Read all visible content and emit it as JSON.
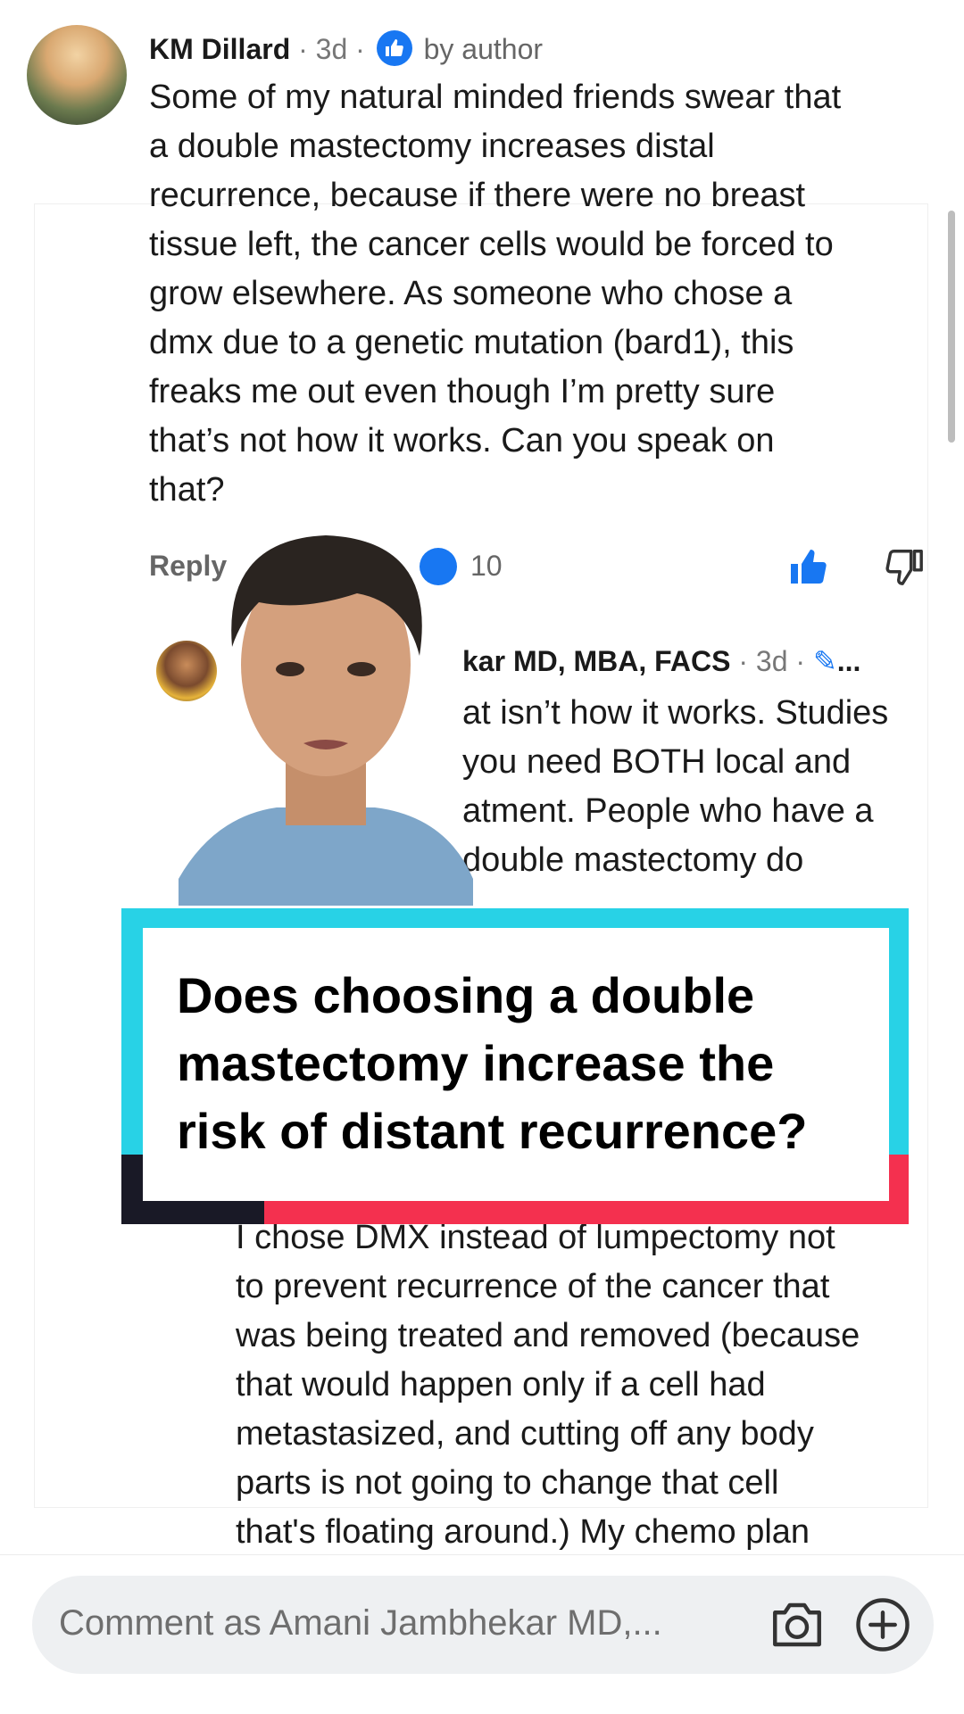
{
  "comment": {
    "author": "KM Dillard",
    "age": "3d",
    "badge_text": "by author",
    "text": "Some of my natural minded friends swear that\na double mastectomy increases distal\nrecurrence, because if there were no breast\ntissue left, the cancer cells would be forced to\ngrow elsewhere. As someone who chose a\ndmx due to a genetic mutation (bard1), this\nfreaks me out even though I’m pretty sure\nthat’s not how it works. Can you speak on\nthat?",
    "reply_label": "Reply",
    "reaction_count": "10"
  },
  "reply": {
    "author_visible": "kar MD, MBA, FACS",
    "age": "3d",
    "text_visible": "at isn’t how it works. Studies\nyou need BOTH local and\natment. People who have a\ndouble mastectomy do"
  },
  "lower_comment": {
    "text": "I chose DMX instead of lumpectomy not\nto prevent recurrence of the cancer that\nwas being treated and removed (because\nthat would happen only if a cell had\nmetastasized, and cutting off any body\nparts is not going to change that cell\nthat's floating around.)  My chemo plan"
  },
  "caption": {
    "text": "Does choosing a double mastectomy increase the risk of distant recurrence?"
  },
  "composer": {
    "placeholder": "Comment as Amani Jambhekar MD,..."
  },
  "colors": {
    "caption_cyan": "#28d2e6",
    "caption_red": "#f4304f",
    "caption_dark": "#191926",
    "like_blue": "#1877f2"
  },
  "icons": [
    "thumbs-up-icon",
    "thumbs-down-icon",
    "camera-icon",
    "plus-icon",
    "edit-icon",
    "more-icon"
  ]
}
